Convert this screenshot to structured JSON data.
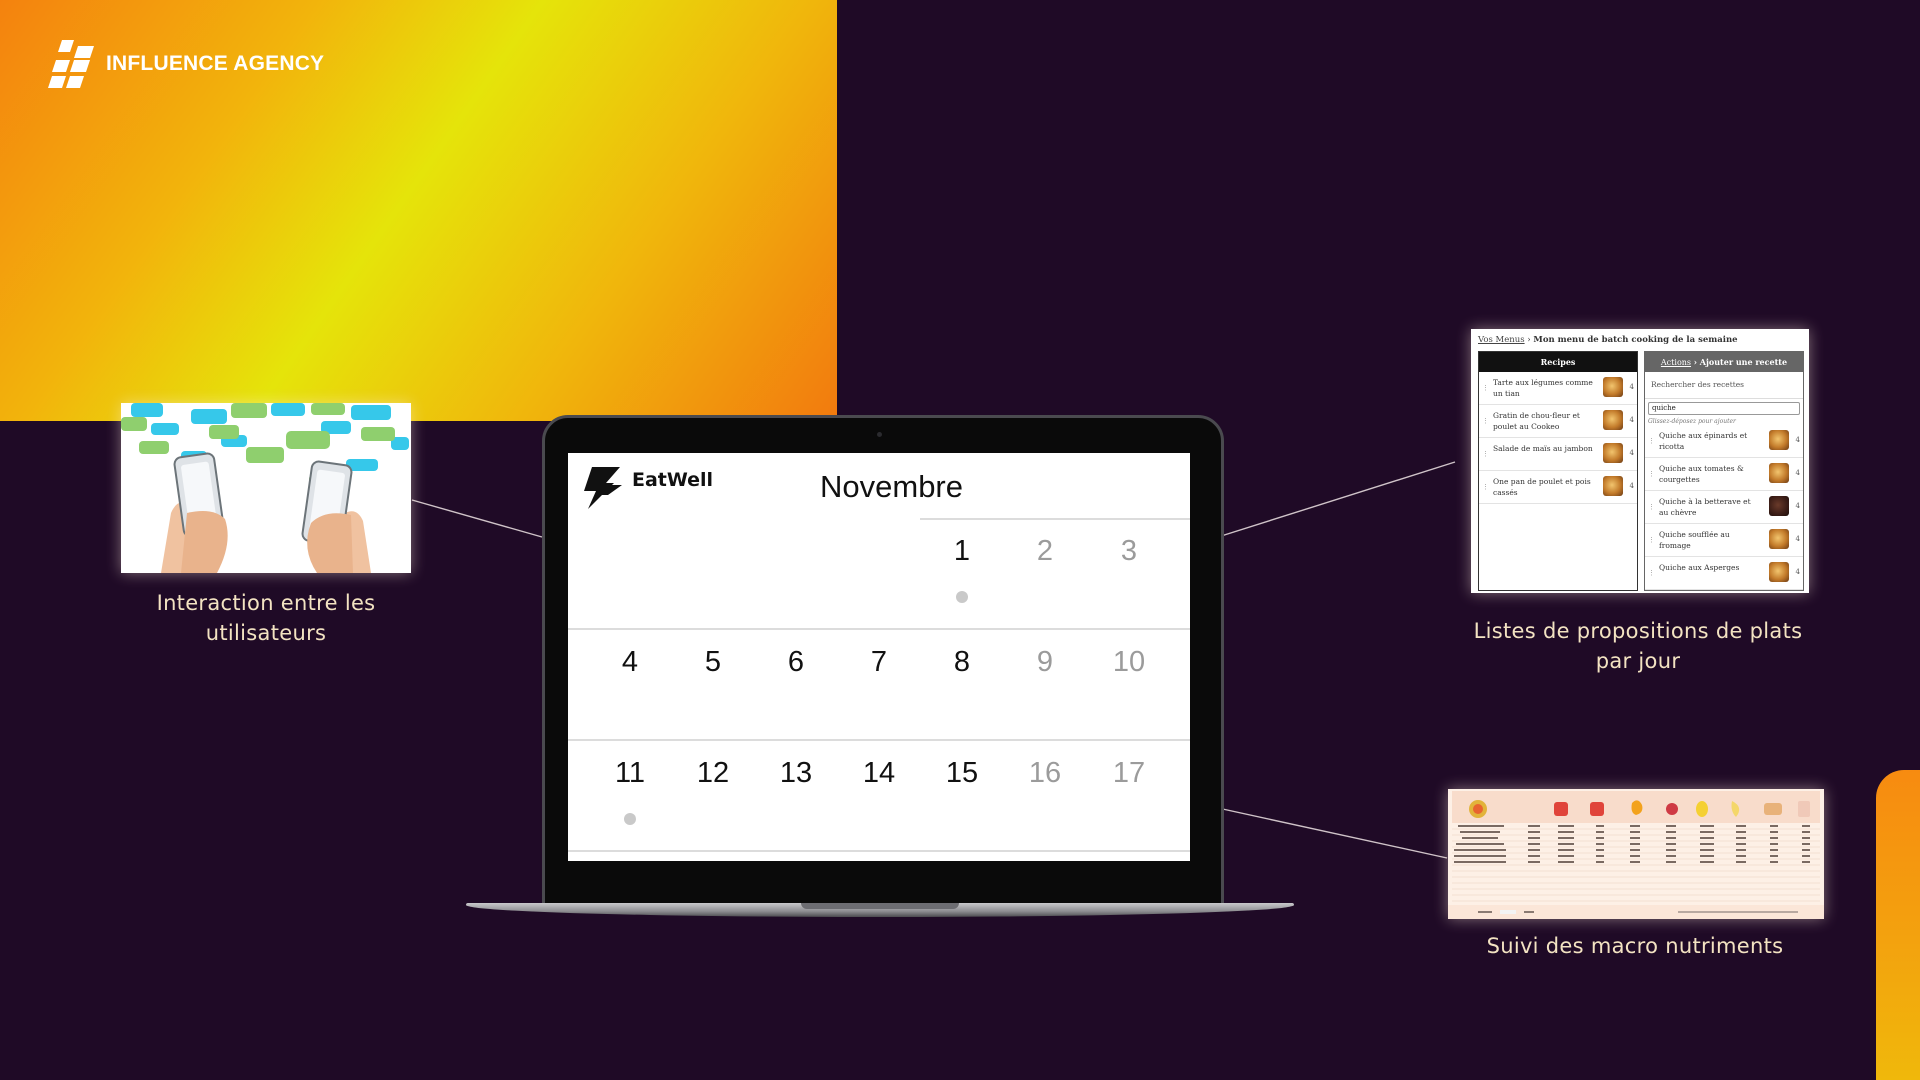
{
  "brand": {
    "name": "INFLUENCE AGENCY"
  },
  "captions": {
    "interaction": "Interaction entre les utilisateurs",
    "propositions": "Listes de propositions de plats par jour",
    "macros": "Suivi des macro nutriments"
  },
  "app": {
    "name": "EatWell",
    "month": "Novembre",
    "weeks": [
      [
        "",
        "",
        "",
        "",
        "1",
        "2",
        "3"
      ],
      [
        "4",
        "5",
        "6",
        "7",
        "8",
        "9",
        "10"
      ],
      [
        "11",
        "12",
        "13",
        "14",
        "15",
        "16",
        "17"
      ]
    ]
  },
  "recipes_thumb": {
    "breadcrumb_link": "Vos Menus",
    "breadcrumb_sep": " › ",
    "breadcrumb_current": "Mon menu de batch cooking de la semaine",
    "left_header": "Recipes",
    "right_header_link": "Actions",
    "right_header_sep": " › ",
    "right_header": "Ajouter une recette",
    "search_label": "Rechercher des recettes",
    "search_value": "quiche",
    "drag_hint": "Glissez-déposez pour ajouter",
    "left_items": [
      "Tarte aux légumes comme un tian",
      "Gratin de chou-fleur et poulet au Cookeo",
      "Salade de maïs au jambon",
      "One pan de poulet et pois cassés"
    ],
    "right_items": [
      "Quiche aux épinards et ricotta",
      "Quiche aux tomates & courgettes",
      "Quiche à la betterave et au chèvre",
      "Quiche soufflée au fromage",
      "Quiche aux Asperges"
    ],
    "count": "4"
  },
  "colors": {
    "background": "#1f0a26",
    "gradient_orange": "#f4820e",
    "gradient_yellow": "#e5e40a",
    "caption": "#f3e3c2"
  }
}
